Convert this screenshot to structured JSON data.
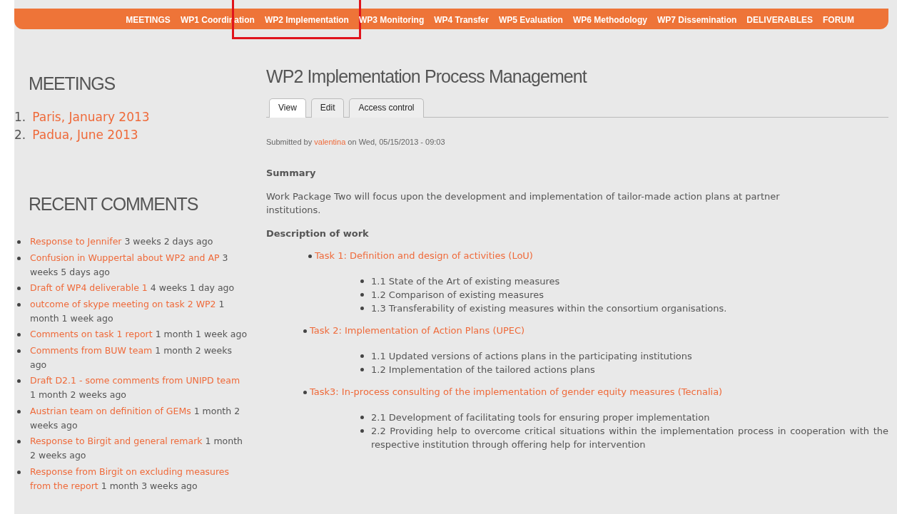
{
  "nav": [
    {
      "label": "MEETINGS",
      "highlighted": false
    },
    {
      "label": "WP1 Coordination",
      "highlighted": false
    },
    {
      "label": "WP2 Implementation",
      "highlighted": true
    },
    {
      "label": "WP3 Monitoring",
      "highlighted": false
    },
    {
      "label": "WP4 Transfer",
      "highlighted": false
    },
    {
      "label": "WP5 Evaluation",
      "highlighted": false
    },
    {
      "label": "WP6 Methodology",
      "highlighted": false
    },
    {
      "label": "WP7 Dissemination",
      "highlighted": false
    },
    {
      "label": "DELIVERABLES",
      "highlighted": false
    },
    {
      "label": "FORUM",
      "highlighted": false
    }
  ],
  "sidebar": {
    "meetings": {
      "title": "MEETINGS",
      "items": [
        {
          "number": "1.",
          "label": "Paris, January 2013"
        },
        {
          "number": "2.",
          "label": "Padua, June 2013"
        }
      ]
    },
    "recent_comments": {
      "title": "RECENT COMMENTS",
      "items": [
        {
          "title": "Response to Jennifer",
          "age": "3 weeks 2 days ago"
        },
        {
          "title": "Confusion in Wuppertal about WP2 and AP",
          "age": "3 weeks 5 days ago"
        },
        {
          "title": "Draft of WP4 deliverable 1",
          "age": "4 weeks 1 day ago"
        },
        {
          "title": "outcome of skype meeting on task 2 WP2",
          "age": "1 month 1 week ago"
        },
        {
          "title": "Comments on task 1 report",
          "age": "1 month 1 week ago"
        },
        {
          "title": "Comments from BUW team",
          "age": "1 month 2 weeks ago"
        },
        {
          "title": "Draft D2.1 - some comments from UNIPD team",
          "age": "1 month 2 weeks ago"
        },
        {
          "title": "Austrian team on definition of GEMs",
          "age": "1 month 2 weeks ago"
        },
        {
          "title": "Response to Birgit and general remark",
          "age": "1 month 2 weeks ago"
        },
        {
          "title": [
            "Response from Birgit on excluding measures",
            "from the report"
          ],
          "age": "1 month 3 weeks ago"
        }
      ]
    }
  },
  "content": {
    "title": "WP2 Implementation Process Management",
    "tabs": [
      {
        "label": "View",
        "selected": true
      },
      {
        "label": "Edit",
        "selected": false
      },
      {
        "label": "Access control",
        "selected": false
      }
    ],
    "submitted": {
      "before": "Submitted by",
      "author": "valentina",
      "after": "on Wed, 05/15/2013 - 09:03"
    },
    "summary_heading": "Summary",
    "summary": "Work Package Two will focus upon the development and implementation of tailor-made action plans at partner institutions.",
    "description_heading": "Description of work",
    "tasks": [
      {
        "label": "Task 1: Definition and design of activities (LoU)",
        "children": [
          {
            "label": "1.1 State of the Art of existing measures"
          },
          {
            "label": "1.2 Comparison of existing measures"
          },
          {
            "label": "1.3 Transferability of existing measures within the consortium organisations."
          }
        ]
      },
      {
        "label": "Task 2: Implementation of Action Plans (UPEC)",
        "children": [
          {
            "label": "1.1 Updated versions of actions plans in the participating institutions"
          },
          {
            "label": "1.2 Implementation of the tailored actions plans"
          }
        ]
      },
      {
        "label": "Task3: In-process consulting of the implementation of gender equity measures (Tecnalia)",
        "children": [
          {
            "label": "2.1 Development of facilitating tools for ensuring proper implementation"
          },
          {
            "label": "2.2 Providing help to overcome critical situations within the implementation process in cooperation with the respective institution through offering help for intervention"
          }
        ]
      }
    ]
  }
}
